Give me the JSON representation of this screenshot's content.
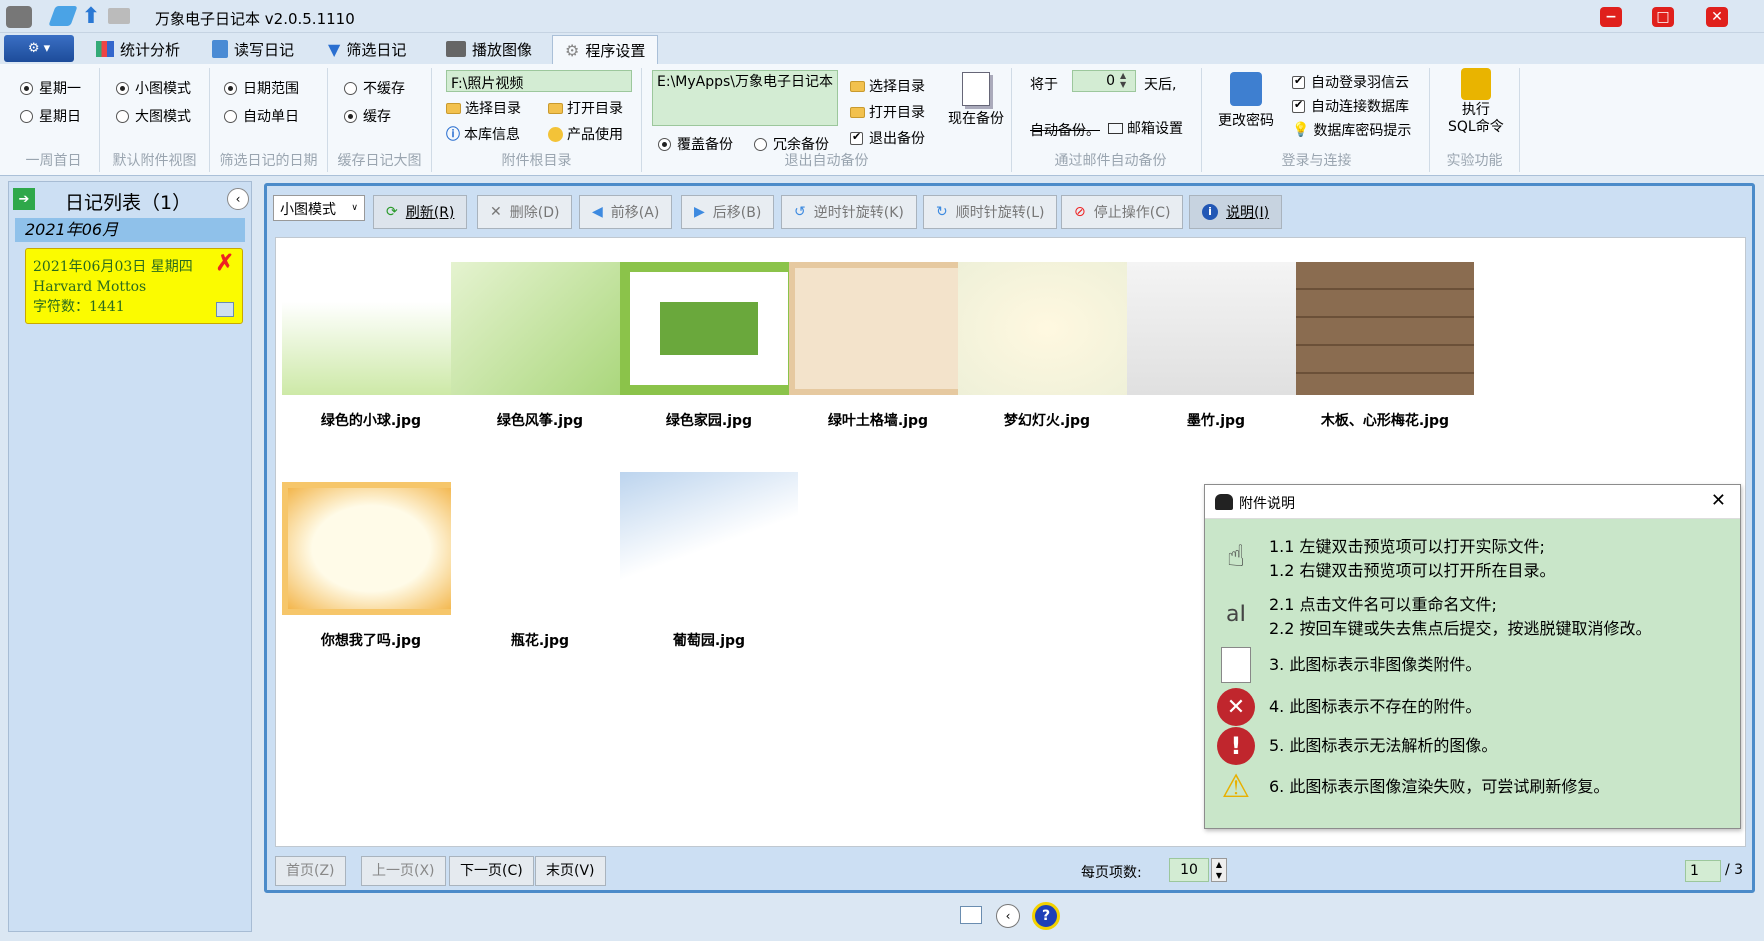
{
  "app": {
    "title": "万象电子日记本 v2.0.5.1110"
  },
  "tabs": [
    "统计分析",
    "读写日记",
    "筛选日记",
    "播放图像",
    "程序设置"
  ],
  "ribbon": {
    "week": {
      "opt1": "星期一",
      "opt2": "星期日",
      "caption": "一周首日"
    },
    "view": {
      "opt1": "小图模式",
      "opt2": "大图模式",
      "caption": "默认附件视图"
    },
    "filter": {
      "opt1": "日期范围",
      "opt2": "自动单日",
      "caption": "筛选日记的日期"
    },
    "cache": {
      "opt1": "不缓存",
      "opt2": "缓存",
      "caption": "缓存日记大图"
    },
    "attach": {
      "path": "F:\\照片视频",
      "select": "选择目录",
      "open": "打开目录",
      "info": "本库信息",
      "usage": "产品使用",
      "caption": "附件根目录"
    },
    "backup": {
      "path": "E:\\MyApps\\万象电子日记本",
      "overwrite": "覆盖备份",
      "redundant": "冗余备份",
      "select": "选择目录",
      "open": "打开目录",
      "on_exit": "退出备份",
      "now": "现在备份",
      "caption": "退出自动备份"
    },
    "mail": {
      "prefix": "将于",
      "days": "0",
      "suffix": "天后,",
      "auto": "自动备份。",
      "settings": "邮箱设置",
      "caption": "通过邮件自动备份"
    },
    "login": {
      "change_pwd": "更改密码",
      "auto_login": "自动登录羽信云",
      "auto_db": "自动连接数据库",
      "pwd_hint": "数据库密码提示",
      "caption": "登录与连接"
    },
    "exp": {
      "sql1": "执行",
      "sql2": "SQL命令",
      "caption": "实验功能"
    }
  },
  "left": {
    "title": "日记列表（1）",
    "month": "2021年06月",
    "entry": {
      "date": "2021年06月03日 星期四",
      "title": "Harvard Mottos",
      "chars": "字符数：1441"
    }
  },
  "toolbar": {
    "mode": "小图模式",
    "refresh": "刷新(R)",
    "delete": "删除(D)",
    "prev": "前移(A)",
    "next": "后移(B)",
    "ccw": "逆时针旋转(K)",
    "cw": "顺时针旋转(L)",
    "stop": "停止操作(C)",
    "help": "说明(I)"
  },
  "files": [
    "绿色的小球.jpg",
    "绿色风筝.jpg",
    "绿色家园.jpg",
    "绿叶土格墙.jpg",
    "梦幻灯火.jpg",
    "墨竹.jpg",
    "木板、心形梅花.jpg",
    "你想我了吗.jpg",
    "瓶花.jpg",
    "葡萄园.jpg"
  ],
  "pager": {
    "first": "首页(Z)",
    "prev": "上一页(X)",
    "next": "下一页(C)",
    "last": "末页(V)",
    "per_page_label": "每页项数:",
    "per_page": "10",
    "page": "1",
    "total": "/ 3"
  },
  "help": {
    "title": "附件说明",
    "l1": "1.1 左键双击预览项可以打开实际文件;",
    "l2": "1.2 右键双击预览项可以打开所在目录。",
    "l3": "2.1 点击文件名可以重命名文件;",
    "l4": "2.2 按回车键或失去焦点后提交，按逃脱键取消修改。",
    "l5": "3. 此图标表示非图像类附件。",
    "l6": "4. 此图标表示不存在的附件。",
    "l7": "5. 此图标表示无法解析的图像。",
    "l8": "6. 此图标表示图像渲染失败，可尝试刷新修复。"
  }
}
